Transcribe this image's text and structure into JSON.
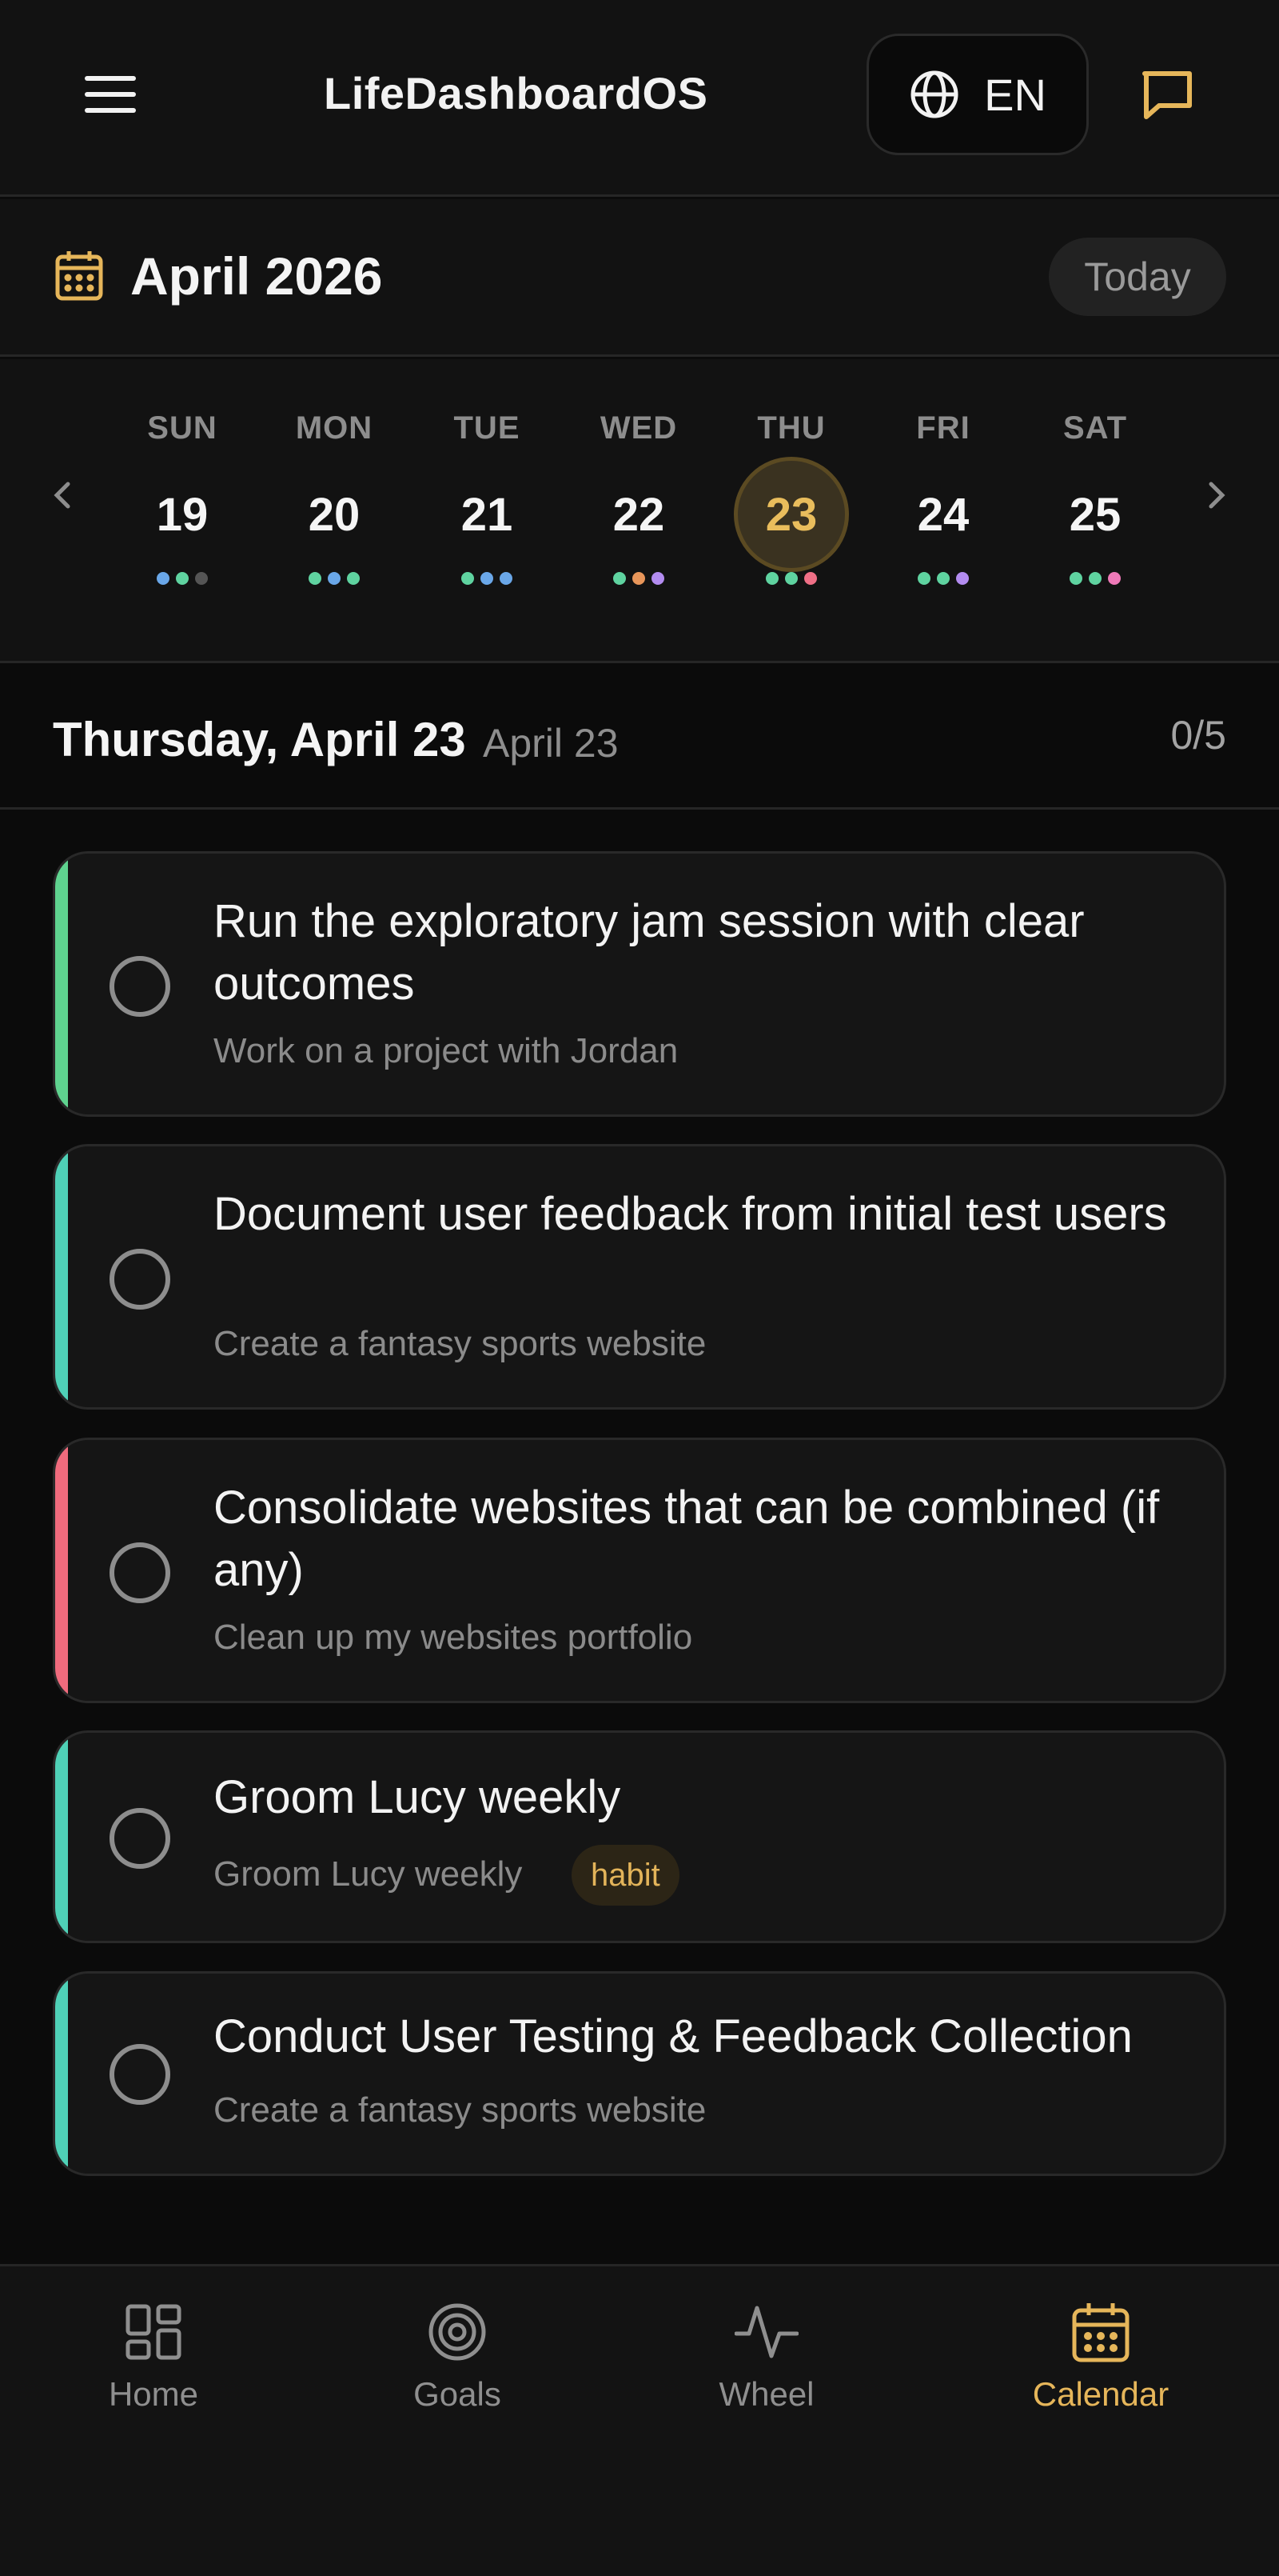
{
  "header": {
    "app_title": "LifeDashboardOS",
    "language": "EN",
    "menu_icon": "hamburger-menu-icon",
    "language_icon": "globe-icon",
    "chat_icon": "chat-bubble-icon"
  },
  "calendar": {
    "month_title": "April 2026",
    "today_label": "Today",
    "week": [
      {
        "name": "SUN",
        "num": "19",
        "dots": [
          "#6aa7e8",
          "#5fd3a0",
          "#555555"
        ]
      },
      {
        "name": "MON",
        "num": "20",
        "dots": [
          "#5fd3a0",
          "#6aa7e8",
          "#5fd3a0"
        ]
      },
      {
        "name": "TUE",
        "num": "21",
        "dots": [
          "#5fd3a0",
          "#6aa7e8",
          "#6aa7e8"
        ]
      },
      {
        "name": "WED",
        "num": "22",
        "dots": [
          "#5fd3a0",
          "#e8965a",
          "#b38cf0"
        ]
      },
      {
        "name": "THU",
        "num": "23",
        "dots": [
          "#5fd3a0",
          "#5fd3a0",
          "#ef6f86"
        ],
        "selected": true
      },
      {
        "name": "FRI",
        "num": "24",
        "dots": [
          "#5fd3a0",
          "#5fd3a0",
          "#b38cf0"
        ]
      },
      {
        "name": "SAT",
        "num": "25",
        "dots": [
          "#5fd3a0",
          "#5fd3a0",
          "#ef79b8"
        ]
      }
    ]
  },
  "day": {
    "title": "Thursday, April 23",
    "subtitle": "April 23",
    "progress": "0/5"
  },
  "tasks": [
    {
      "title": "Run the exploratory jam session with clear outcomes",
      "subtitle": "Work on a project with Jordan",
      "color": "#5fd38f"
    },
    {
      "title": "Document user feedback from initial test users",
      "subtitle": "Create a fantasy sports website",
      "color": "#4fd1b7"
    },
    {
      "title": "Consolidate websites that can be combined (if any)",
      "subtitle": "Clean up my websites portfolio",
      "color": "#f06b7d"
    },
    {
      "title": "Groom Lucy weekly",
      "subtitle": "Groom Lucy weekly",
      "badge": "habit",
      "color": "#4fd1b7"
    },
    {
      "title": "Conduct User Testing & Feedback Collection",
      "subtitle": "Create a fantasy sports website",
      "color": "#4fd1b7"
    }
  ],
  "nav": {
    "items": [
      {
        "label": "Home",
        "icon": "home-grid-icon"
      },
      {
        "label": "Goals",
        "icon": "target-icon"
      },
      {
        "label": "Wheel",
        "icon": "activity-wave-icon"
      },
      {
        "label": "Calendar",
        "icon": "calendar-icon",
        "active": true
      }
    ]
  },
  "colors": {
    "accent": "#e6b65a",
    "background": "#0b0b0b",
    "surface": "#151515"
  }
}
